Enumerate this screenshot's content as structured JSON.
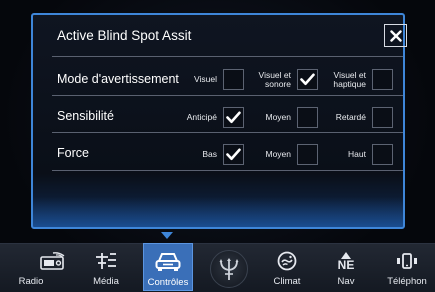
{
  "dialog": {
    "title": "Active Blind Spot Assit",
    "close_icon": "close-icon"
  },
  "rows": [
    {
      "label": "Mode d'avertissement",
      "options": [
        {
          "label": "Visuel",
          "checked": false
        },
        {
          "label_line1": "Visuel et",
          "label_line2": "sonore",
          "checked": true
        },
        {
          "label_line1": "Visuel et",
          "label_line2": "haptique",
          "checked": false
        }
      ]
    },
    {
      "label": "Sensibilité",
      "options": [
        {
          "label": "Anticipé",
          "checked": true
        },
        {
          "label": "Moyen",
          "checked": false
        },
        {
          "label": "Retardé",
          "checked": false
        }
      ]
    },
    {
      "label": "Force",
      "options": [
        {
          "label": "Bas",
          "checked": true
        },
        {
          "label": "Moyen",
          "checked": false
        },
        {
          "label": "Haut",
          "checked": false
        }
      ]
    }
  ],
  "nav": {
    "items": [
      {
        "label": "Radio",
        "icon": "radio-icon"
      },
      {
        "label": "Média",
        "icon": "media-icon"
      },
      {
        "label": "Contrôles",
        "icon": "car-icon",
        "active": true
      },
      {
        "label": "",
        "icon": "trident-logo-icon"
      },
      {
        "label": "Climat",
        "icon": "climate-icon"
      },
      {
        "label": "Nav",
        "icon": "compass-icon",
        "glyph": "NE"
      },
      {
        "label": "Téléphon",
        "icon": "phone-icon"
      }
    ]
  },
  "colors": {
    "accent": "#3e86d9",
    "active_tab": "#3a6fb8",
    "background": "#06090f"
  }
}
